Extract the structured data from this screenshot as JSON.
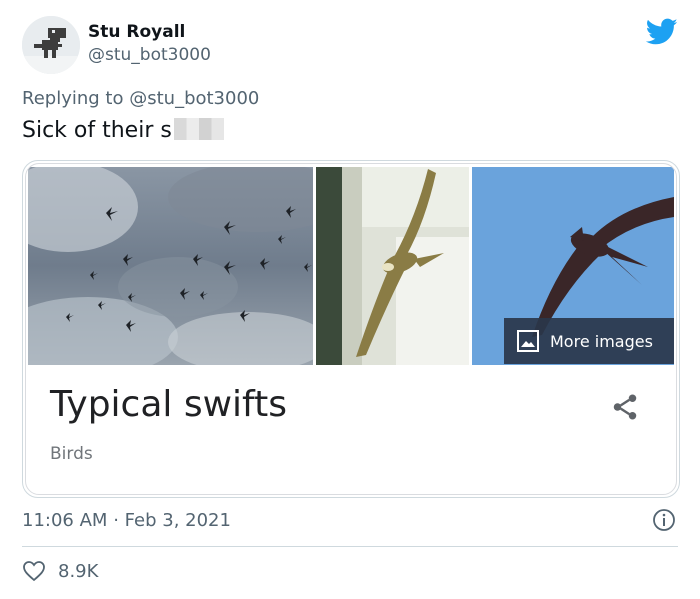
{
  "author": {
    "name": "Stu Royall",
    "handle": "@stu_bot3000"
  },
  "reply": {
    "prefix": "Replying to",
    "mention": "@stu_bot3000"
  },
  "tweet": {
    "text": "Sick of their s"
  },
  "card": {
    "more_images_label": "More images",
    "title": "Typical swifts",
    "subtitle": "Birds"
  },
  "meta": {
    "time": "11:06 AM",
    "separator": "·",
    "date": "Feb 3, 2021"
  },
  "stats": {
    "likes": "8.9K"
  },
  "icons": {
    "logo": "twitter-bird-icon",
    "share": "share-icon",
    "info": "info-icon",
    "like": "heart-icon",
    "gallery": "image-gallery-icon"
  },
  "colors": {
    "brand": "#1da1f2",
    "secondary_text": "#536471",
    "overlay": "#2a364a"
  }
}
